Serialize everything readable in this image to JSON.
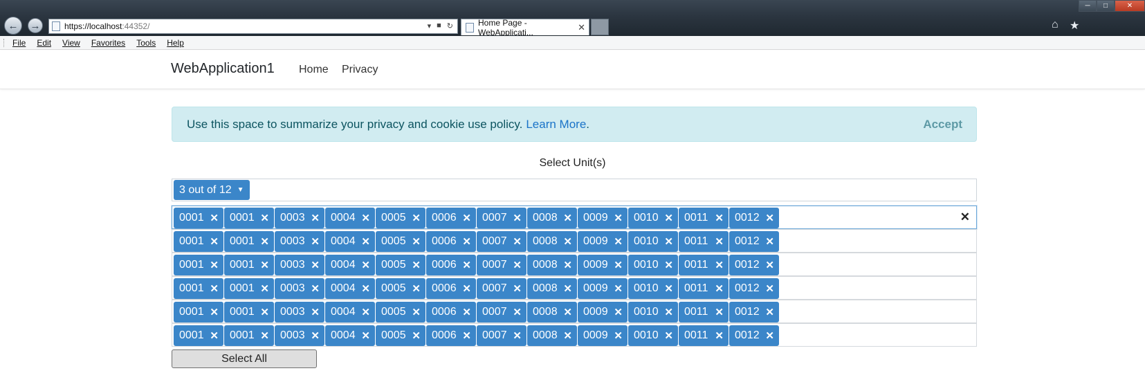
{
  "browser": {
    "address_host": "https://localhost",
    "address_port": ":44352/",
    "tab_title": "Home Page - WebApplicati...",
    "tab_close": "✕",
    "menu": [
      "File",
      "Edit",
      "View",
      "Favorites",
      "Tools",
      "Help"
    ]
  },
  "header": {
    "brand": "WebApplication1",
    "nav": [
      "Home",
      "Privacy"
    ]
  },
  "cookie": {
    "message": "Use this space to summarize your privacy and cookie use policy.",
    "link": "Learn More",
    "period": ".",
    "accept": "Accept"
  },
  "selector": {
    "label": "Select Unit(s)",
    "count": "3 out of 12",
    "remove_glyph": "✕",
    "clear_glyph": "✕",
    "rows": [
      [
        "0001",
        "0001",
        "0003",
        "0004",
        "0005",
        "0006",
        "0007",
        "0008",
        "0009",
        "0010",
        "0011",
        "0012"
      ],
      [
        "0001",
        "0001",
        "0003",
        "0004",
        "0005",
        "0006",
        "0007",
        "0008",
        "0009",
        "0010",
        "0011",
        "0012"
      ],
      [
        "0001",
        "0001",
        "0003",
        "0004",
        "0005",
        "0006",
        "0007",
        "0008",
        "0009",
        "0010",
        "0011",
        "0012"
      ],
      [
        "0001",
        "0001",
        "0003",
        "0004",
        "0005",
        "0006",
        "0007",
        "0008",
        "0009",
        "0010",
        "0011",
        "0012"
      ],
      [
        "0001",
        "0001",
        "0003",
        "0004",
        "0005",
        "0006",
        "0007",
        "0008",
        "0009",
        "0010",
        "0011",
        "0012"
      ],
      [
        "0001",
        "0001",
        "0003",
        "0004",
        "0005",
        "0006",
        "0007",
        "0008",
        "0009",
        "0010",
        "0011",
        "0012"
      ]
    ],
    "select_all": "Select All"
  },
  "colors": {
    "tag_bg": "#3b86c9",
    "alert_bg": "#d1ecf1",
    "alert_text": "#0c5460",
    "link": "#1a73c8"
  }
}
